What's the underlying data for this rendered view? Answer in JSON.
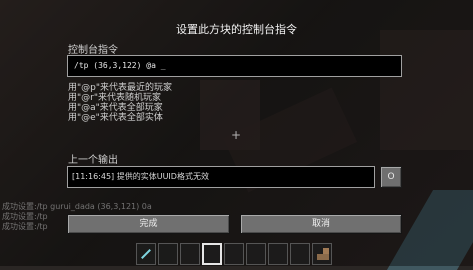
{
  "dialog": {
    "title": "设置此方块的控制台指令",
    "command_label": "控制台指令",
    "command_value": "/tp (36,3,122) @a _",
    "hints": [
      "用\"@p\"来代表最近的玩家",
      "用\"@r\"来代表随机玩家",
      "用\"@a\"来代表全部玩家",
      "用\"@e\"来代表全部实体"
    ],
    "output_label": "上一个输出",
    "output_value": "[11:16:45] 提供的实体UUID格式无效",
    "output_toggle": "O",
    "done_button": "完成",
    "cancel_button": "取消"
  },
  "chat": {
    "lines": [
      "成功设置:/tp gurui_dada (36,3,121) 0a",
      "成功设置:/tp",
      "成功设置:/tp"
    ]
  },
  "crosshair": "+",
  "hotbar": {
    "slots": [
      "diamond-sword",
      "empty",
      "empty",
      "empty",
      "empty",
      "empty",
      "empty",
      "empty",
      "stairs"
    ]
  }
}
